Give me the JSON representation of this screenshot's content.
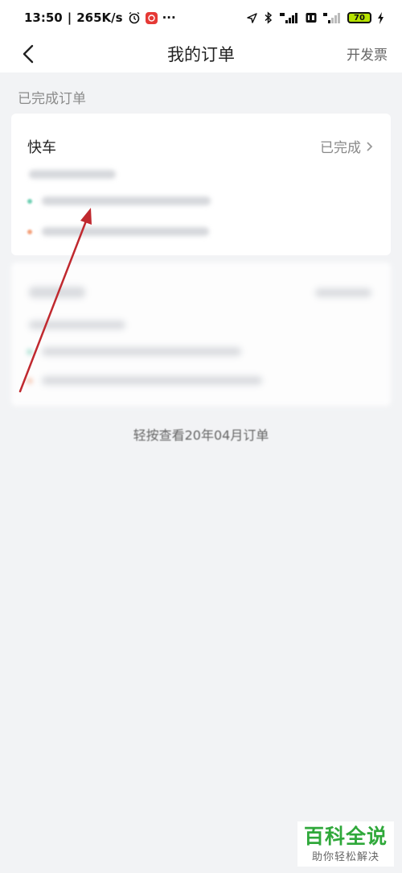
{
  "status_bar": {
    "time": "13:50",
    "separator": "|",
    "net_speed": "265K/s",
    "more": "···",
    "battery_level": "70"
  },
  "header": {
    "title": "我的订单",
    "invoice_label": "开发票"
  },
  "section": {
    "title": "已完成订单"
  },
  "orders": [
    {
      "type": "快车",
      "status": "已完成"
    }
  ],
  "footer": {
    "more_orders": "轻按查看20年04月订单"
  },
  "watermark": {
    "title": "百科全说",
    "subtitle": "助你轻松解决"
  },
  "colors": {
    "accent_green": "#2fa83a",
    "annotation_red": "#c0292f",
    "background": "#f2f3f5"
  }
}
